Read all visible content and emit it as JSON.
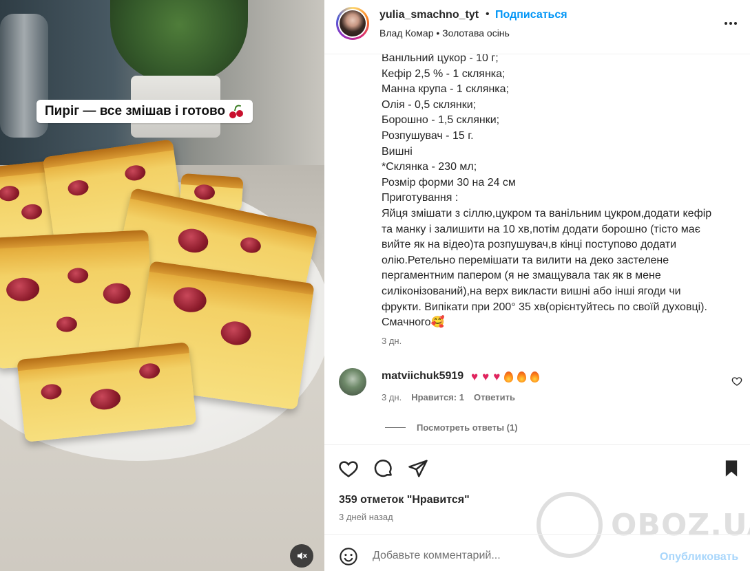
{
  "media": {
    "overlay_caption": "Пиріг — все змішав і готово",
    "overlay_emoji": "cherry-icon",
    "mute_icon": "volume-off-icon"
  },
  "header": {
    "username": "yulia_smachno_tyt",
    "separator": "•",
    "follow_label": "Подписаться",
    "subline": "Влад Комар • Золотава осінь",
    "more_icon": "more-horizontal-icon"
  },
  "caption": {
    "lines": [
      "Ванільний цукор - 10 г;",
      "Кефір 2,5 % - 1 склянка;",
      "Манна крупа - 1 склянка;",
      "Олія - 0,5 склянки;",
      "Борошно - 1,5 склянки;",
      "Розпушувач - 15 г.",
      "Вишні",
      "*Склянка - 230 мл;",
      "Розмір форми 30 на 24 см",
      "Приготування :",
      "Яйця змішати з сіллю,цукром та ванільним цукром,додати кефір",
      "та манку і залишити на 10 хв,потім додати борошно (тісто має",
      "вийте як на відео)та розпушувач,в кінці поступово додати",
      "олію.Ретельно перемішати та вилити на деко застелене",
      "пергаментним папером (я не змащувала так як в мене",
      "силіконізований),на верх викласти вишні або інші ягоди чи",
      "фрукти. Випікати при 200° 35 хв(орієнтуйтесь по своїй духовці).",
      "Смачного🥰"
    ],
    "age": "3 дн."
  },
  "comment": {
    "username": "matviichuk5919",
    "emojis": [
      "heart",
      "heart",
      "heart",
      "fire",
      "fire",
      "fire"
    ],
    "age": "3 дн.",
    "likes": "Нравится: 1",
    "reply_label": "Ответить",
    "view_replies": "Посмотреть ответы (1)"
  },
  "actions": {
    "likes_count": "359 отметок \"Нравится\"",
    "post_age": "3 дней назад"
  },
  "watermark": "OBOZ.UA",
  "comment_bar": {
    "placeholder": "Добавьте комментарий...",
    "publish_label": "Опубликовать"
  },
  "colors": {
    "accent": "#0095f6",
    "publish_disabled": "#a8d6fb",
    "secondary_text": "#737373"
  }
}
